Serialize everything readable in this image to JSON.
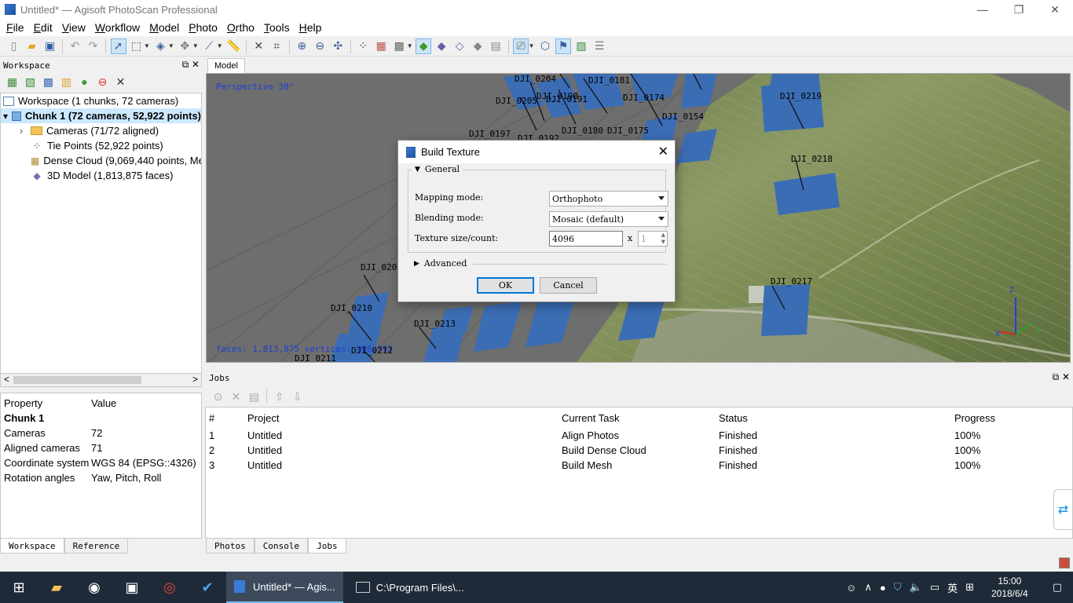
{
  "window": {
    "title": "Untitled* — Agisoft PhotoScan Professional",
    "minimize": "—",
    "maximize": "❐",
    "close": "✕"
  },
  "menu": [
    "File",
    "Edit",
    "View",
    "Workflow",
    "Model",
    "Photo",
    "Ortho",
    "Tools",
    "Help"
  ],
  "workspace": {
    "header": "Workspace",
    "tree": [
      {
        "label": "Workspace (1 chunks, 72 cameras)",
        "icon": "workspace-icon",
        "indent": 0,
        "expander": ""
      },
      {
        "label": "Chunk 1 (72 cameras, 52,922 points)",
        "icon": "chunk-icon",
        "indent": 0,
        "expander": "▾",
        "selected": true
      },
      {
        "label": "Cameras (71/72 aligned)",
        "icon": "folder-icon",
        "indent": 1,
        "expander": "›"
      },
      {
        "label": "Tie Points (52,922 points)",
        "icon": "tie-points-icon",
        "indent": 1,
        "expander": ""
      },
      {
        "label": "Dense Cloud (9,069,440 points, Medium quality)",
        "icon": "dense-cloud-icon",
        "indent": 1,
        "expander": ""
      },
      {
        "label": "3D Model (1,813,875 faces)",
        "icon": "model-icon",
        "indent": 1,
        "expander": ""
      }
    ],
    "scroll_left": "<",
    "scroll_right": ">"
  },
  "properties": {
    "col_property": "Property",
    "col_value": "Value",
    "title": "Chunk 1",
    "rows": [
      {
        "k": "Cameras",
        "v": "72"
      },
      {
        "k": "Aligned cameras",
        "v": "71"
      },
      {
        "k": "Coordinate system",
        "v": "WGS 84 (EPSG::4326)"
      },
      {
        "k": "Rotation angles",
        "v": "Yaw, Pitch, Roll"
      }
    ]
  },
  "left_tabs": [
    "Workspace",
    "Reference"
  ],
  "model": {
    "tab": "Model",
    "perspective": "Perspective 30°",
    "stats": "faces: 1,813,875 vertices: 906,992",
    "axis_z": "Z",
    "axis_y": "Y",
    "axis_x": "X",
    "cameras": [
      {
        "label": "DJI_0204"
      },
      {
        "label": "DJI_0181"
      },
      {
        "label": "DJI_0205"
      },
      {
        "label": "DJI_0190"
      },
      {
        "label": "DJI_0191"
      },
      {
        "label": "DJI_0174"
      },
      {
        "label": "DJI_0219"
      },
      {
        "label": "DJI_0154"
      },
      {
        "label": "DJI_0180"
      },
      {
        "label": "DJI_0175"
      },
      {
        "label": "DJI_0197"
      },
      {
        "label": "DJI_0192"
      },
      {
        "label": "DJI_0218"
      },
      {
        "label": "DJI_0209"
      },
      {
        "label": "DJI_0217"
      },
      {
        "label": "DJI_0210"
      },
      {
        "label": "DJI_0213"
      },
      {
        "label": "DJI_0212"
      },
      {
        "label": "DJI_0211"
      }
    ]
  },
  "jobs": {
    "header": "Jobs",
    "columns": [
      "#",
      "Project",
      "Current Task",
      "Status",
      "Progress"
    ],
    "rows": [
      {
        "n": "1",
        "project": "Untitled",
        "task": "Align Photos",
        "status": "Finished",
        "progress": "100%"
      },
      {
        "n": "2",
        "project": "Untitled",
        "task": "Build Dense Cloud",
        "status": "Finished",
        "progress": "100%"
      },
      {
        "n": "3",
        "project": "Untitled",
        "task": "Build Mesh",
        "status": "Finished",
        "progress": "100%"
      }
    ]
  },
  "bottom_tabs": [
    "Photos",
    "Console",
    "Jobs"
  ],
  "dialog": {
    "title": "Build Texture",
    "general": "General",
    "mapping_label": "Mapping mode:",
    "mapping_value": "Orthophoto",
    "blending_label": "Blending mode:",
    "blending_value": "Mosaic (default)",
    "texture_label": "Texture size/count:",
    "texture_size": "4096",
    "times": "x",
    "texture_count": "1",
    "advanced": "Advanced",
    "ok": "OK",
    "cancel": "Cancel"
  },
  "taskbar": {
    "tasks": [
      {
        "label": "Untitled* — Agis...",
        "active": true
      },
      {
        "label": "C:\\Program Files\\...",
        "active": false
      }
    ],
    "lang": "英",
    "time": "15:00",
    "date": "2018/6/4"
  },
  "colors": {
    "accent": "#0078d7",
    "camera_blue": "#3b6db5",
    "selection": "#cce8ff",
    "taskbar": "#1f2a38"
  }
}
